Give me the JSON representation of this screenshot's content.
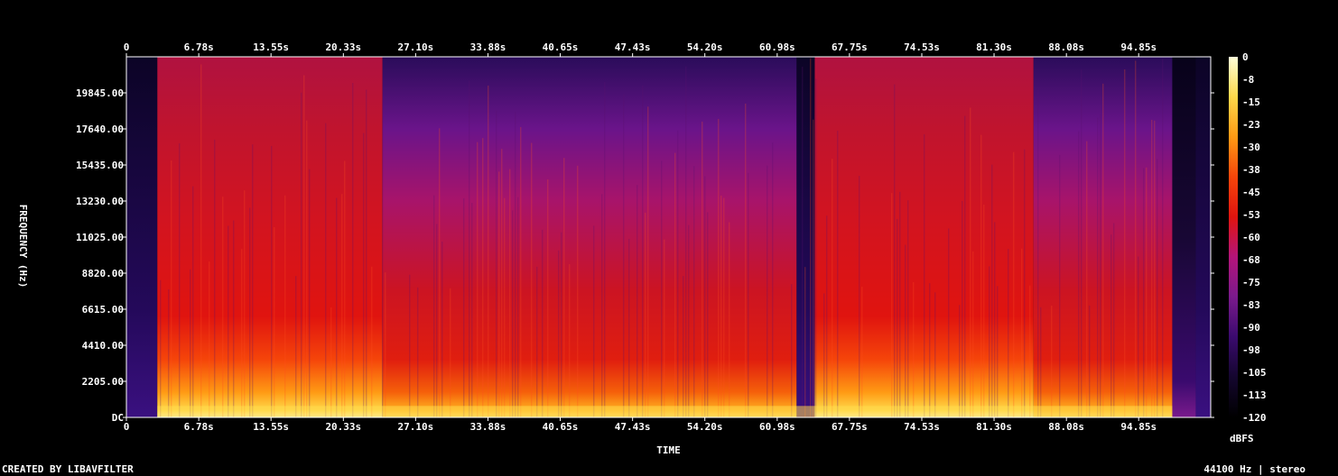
{
  "chart_data": {
    "type": "heatmap",
    "title": "",
    "xlabel": "TIME",
    "ylabel": "FREQUENCY (Hz)",
    "x_ticks": [
      "0",
      "6.78s",
      "13.55s",
      "20.33s",
      "27.10s",
      "33.88s",
      "40.65s",
      "47.43s",
      "54.20s",
      "60.98s",
      "67.75s",
      "74.53s",
      "81.30s",
      "88.08s",
      "94.85s"
    ],
    "x_tick_values": [
      0,
      6.78,
      13.55,
      20.33,
      27.1,
      33.88,
      40.65,
      47.43,
      54.2,
      60.98,
      67.75,
      74.53,
      81.3,
      88.08,
      94.85
    ],
    "xlim": [
      0,
      101.6
    ],
    "y_ticks": [
      "DC",
      "2205.00",
      "4410.00",
      "6615.00",
      "8820.00",
      "11025.00",
      "13230.00",
      "15435.00",
      "17640.00",
      "19845.00"
    ],
    "y_tick_values": [
      0,
      2205,
      4410,
      6615,
      8820,
      11025,
      13230,
      15435,
      17640,
      19845
    ],
    "ylim": [
      0,
      22050
    ],
    "colorbar": {
      "label": "dBFS",
      "ticks": [
        "0",
        "-8",
        "-15",
        "-23",
        "-30",
        "-38",
        "-45",
        "-53",
        "-60",
        "-68",
        "-75",
        "-83",
        "-90",
        "-98",
        "-105",
        "-113",
        "-120"
      ],
      "range": [
        -120,
        0
      ],
      "colors": [
        "#000000",
        "#14062e",
        "#3a0a6e",
        "#7a1a8c",
        "#b4147a",
        "#e0140f",
        "#f5450a",
        "#ff9a14",
        "#ffd84a",
        "#ffffd8"
      ]
    },
    "silent_regions_s": [
      [
        0,
        2.9
      ],
      [
        62.8,
        64.5
      ],
      [
        100.2,
        101.6
      ]
    ],
    "bright_regions_s": [
      [
        2.9,
        24.0
      ],
      [
        64.5,
        98.0
      ]
    ]
  },
  "footer": {
    "left": "CREATED BY LIBAVFILTER",
    "right": "44100 Hz | stereo"
  }
}
